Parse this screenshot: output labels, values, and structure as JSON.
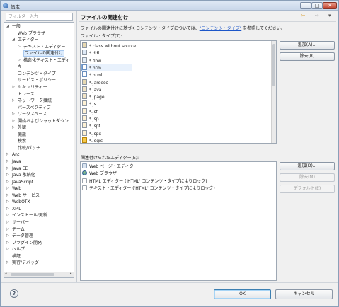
{
  "window": {
    "title": "設定",
    "min": "–",
    "max": "□",
    "close": "✕"
  },
  "filter": {
    "placeholder": "フィルター入力"
  },
  "tree": [
    {
      "label": "一般",
      "twisty": "◢",
      "indent": 0
    },
    {
      "label": "Web ブラウザー",
      "twisty": "",
      "indent": 1
    },
    {
      "label": "エディター",
      "twisty": "◢",
      "indent": 1
    },
    {
      "label": "テキスト・エディター",
      "twisty": "▷",
      "indent": 2
    },
    {
      "label": "ファイルの関連付け",
      "twisty": "",
      "indent": 2,
      "selected": true
    },
    {
      "label": "構造化テキスト・エディ",
      "twisty": "▷",
      "indent": 2
    },
    {
      "label": "キー",
      "twisty": "",
      "indent": 1
    },
    {
      "label": "コンテンツ・タイプ",
      "twisty": "",
      "indent": 1
    },
    {
      "label": "サービス・ポリシー",
      "twisty": "",
      "indent": 1
    },
    {
      "label": "セキュリティー",
      "twisty": "▷",
      "indent": 1
    },
    {
      "label": "トレース",
      "twisty": "",
      "indent": 1
    },
    {
      "label": "ネットワーク接続",
      "twisty": "▷",
      "indent": 1
    },
    {
      "label": "パースペクティブ",
      "twisty": "",
      "indent": 1
    },
    {
      "label": "ワークスペース",
      "twisty": "▷",
      "indent": 1
    },
    {
      "label": "開始およびシャットダウン",
      "twisty": "▷",
      "indent": 1
    },
    {
      "label": "外観",
      "twisty": "▷",
      "indent": 1
    },
    {
      "label": "機能",
      "twisty": "",
      "indent": 1
    },
    {
      "label": "検索",
      "twisty": "",
      "indent": 1
    },
    {
      "label": "比較/パッチ",
      "twisty": "",
      "indent": 1
    },
    {
      "label": "Ant",
      "twisty": "▷",
      "indent": 0
    },
    {
      "label": "Java",
      "twisty": "▷",
      "indent": 0
    },
    {
      "label": "Java EE",
      "twisty": "▷",
      "indent": 0
    },
    {
      "label": "Java 永続化",
      "twisty": "▷",
      "indent": 0
    },
    {
      "label": "JavaScript",
      "twisty": "▷",
      "indent": 0
    },
    {
      "label": "Web",
      "twisty": "▷",
      "indent": 0
    },
    {
      "label": "Web サービス",
      "twisty": "▷",
      "indent": 0
    },
    {
      "label": "WebOTX",
      "twisty": "▷",
      "indent": 0
    },
    {
      "label": "XML",
      "twisty": "▷",
      "indent": 0
    },
    {
      "label": "インストール/更新",
      "twisty": "▷",
      "indent": 0
    },
    {
      "label": "サーバー",
      "twisty": "▷",
      "indent": 0
    },
    {
      "label": "チーム",
      "twisty": "▷",
      "indent": 0
    },
    {
      "label": "データ管理",
      "twisty": "▷",
      "indent": 0
    },
    {
      "label": "プラグイン開発",
      "twisty": "▷",
      "indent": 0
    },
    {
      "label": "ヘルプ",
      "twisty": "▷",
      "indent": 0
    },
    {
      "label": "検証",
      "twisty": "",
      "indent": 0
    },
    {
      "label": "実行/デバッグ",
      "twisty": "▷",
      "indent": 0
    }
  ],
  "header": {
    "title": "ファイルの関連付け",
    "back": "⇦",
    "forward": "⇨",
    "menu": "▾"
  },
  "description": {
    "before": "ファイルの関連付けに基づくコンテンツ・タイプについては、",
    "link": "\"コンテンツ・タイプ\"",
    "after": " を参照してください。"
  },
  "filetypes": {
    "label": "ファイル・タイプ(T):",
    "items": [
      {
        "name": "*.class without source",
        "icon": "jar"
      },
      {
        "name": "*.ddl",
        "icon": "img"
      },
      {
        "name": "*.flow",
        "icon": "flow"
      },
      {
        "name": "*.htm",
        "icon": "html",
        "selected": true
      },
      {
        "name": "*.html",
        "icon": "html"
      },
      {
        "name": "*.jardesc",
        "icon": "jar"
      },
      {
        "name": "*.java",
        "icon": "java"
      },
      {
        "name": "*.jpage",
        "icon": "java"
      },
      {
        "name": "*.js",
        "icon": "js"
      },
      {
        "name": "*.jsf",
        "icon": "js"
      },
      {
        "name": "*.jsp",
        "icon": "js"
      },
      {
        "name": "*.jspf",
        "icon": "js"
      },
      {
        "name": "*.jspx",
        "icon": "js"
      },
      {
        "name": "*.logic",
        "icon": "logic"
      }
    ],
    "add": "追加(A)...",
    "remove": "除去(R)"
  },
  "editors": {
    "label": "関連付けられたエディター(E):",
    "items": [
      {
        "name": "Web ページ・エディター",
        "icon": "page"
      },
      {
        "name": "Web ブラウザー",
        "icon": "globe"
      },
      {
        "name": "HTML エディター ('HTML' コンテンツ・タイプによりロック)",
        "icon": "text"
      },
      {
        "name": "テキスト・エディター ('HTML' コンテンツ・タイプによりロック)",
        "icon": "text"
      }
    ],
    "add": "追加(D)...",
    "remove": "除去(M)",
    "default": "デフォルト(E)"
  },
  "footer": {
    "help": "?",
    "ok": "OK",
    "cancel": "キャンセル"
  }
}
